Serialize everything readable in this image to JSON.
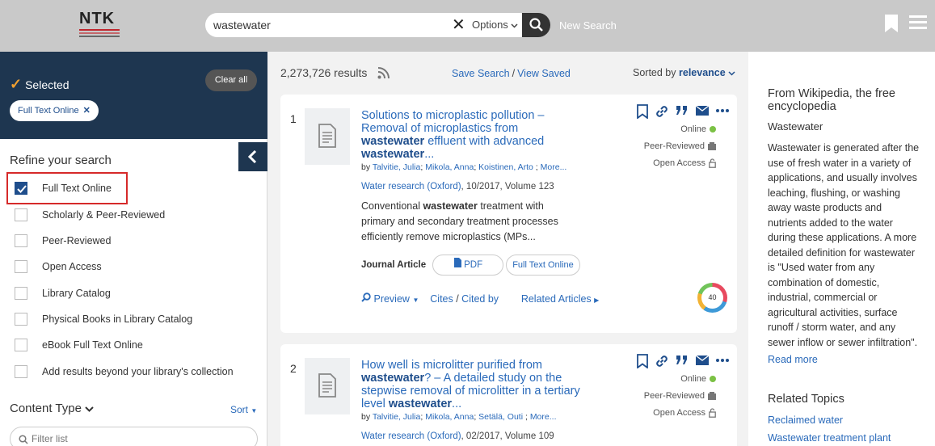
{
  "header": {
    "logo_text": "NTK",
    "search_value": "wastewater",
    "search_placeholder": "",
    "options_label": "Options",
    "new_search_label": "New Search"
  },
  "sidebar": {
    "selected_title": "Selected",
    "clear_all_label": "Clear all",
    "chips": [
      {
        "label": "Full Text Online"
      }
    ],
    "refine_title": "Refine your search",
    "filters": [
      {
        "label": "Full Text Online",
        "checked": true
      },
      {
        "label": "Scholarly & Peer-Reviewed",
        "checked": false
      },
      {
        "label": "Peer-Reviewed",
        "checked": false
      },
      {
        "label": "Open Access",
        "checked": false
      },
      {
        "label": "Library Catalog",
        "checked": false
      },
      {
        "label": "Physical Books in Library Catalog",
        "checked": false
      },
      {
        "label": "eBook Full Text Online",
        "checked": false
      },
      {
        "label": "Add results beyond your library's collection",
        "checked": false
      }
    ],
    "content_type_title": "Content Type",
    "sort_label": "Sort",
    "filter_list_placeholder": "Filter list"
  },
  "results_header": {
    "count": "2,273,726 results",
    "save_search": "Save Search",
    "separator": "/",
    "view_saved": "View Saved",
    "sorted_by_label": "Sorted by",
    "sort_value": "relevance"
  },
  "results": [
    {
      "rank": "1",
      "title_parts": [
        "Solutions to microplastic pollution – Removal of microplastics from ",
        "wastewater",
        " effluent with advanced ",
        "wastewater",
        "..."
      ],
      "authors_by": "by",
      "authors": [
        "Talvitie, Julia",
        "Mikola, Anna",
        "Koistinen, Arto",
        "More..."
      ],
      "journal": "Water research (Oxford)",
      "journal_details": ", 10/2017, Volume 123",
      "snippet_parts": [
        "Conventional ",
        "wastewater",
        " treatment with primary and secondary treatment processes efficiently remove microplastics (MPs..."
      ],
      "type": "Journal Article",
      "pdf_label": "PDF",
      "fto_label": "Full Text Online",
      "preview_label": "Preview",
      "cites_label": "Cites",
      "cited_by_label": "Cited by",
      "related_label": "Related Articles",
      "altmetric": "40",
      "status": [
        "Online",
        "Peer-Reviewed",
        "Open Access"
      ]
    },
    {
      "rank": "2",
      "title_parts": [
        "How well is microlitter purified from ",
        "wastewater",
        "? – A detailed study on the stepwise removal of microlitter in a tertiary level ",
        "wastewater",
        "..."
      ],
      "authors_by": "by",
      "authors": [
        "Talvitie, Julia",
        "Mikola, Anna",
        "Setälä, Outi",
        "More..."
      ],
      "journal": "Water research (Oxford)",
      "journal_details": ", 02/2017, Volume 109",
      "status": [
        "Online",
        "Peer-Reviewed",
        "Open Access"
      ]
    }
  ],
  "wiki": {
    "title": "From Wikipedia, the free encyclopedia",
    "term": "Wastewater",
    "body": "Wastewater is generated after the use of fresh water in a variety of applications, and usually involves leaching, flushing, or washing away waste products and nutrients added to the water during these applications. A more detailed definition for wastewater is \"Used water from any combination of domestic, industrial, commercial or agricultural activities, surface runoff / storm water, and any sewer inflow or sewer infiltration\".",
    "read_more": "Read more",
    "related_title": "Related Topics",
    "topics": [
      "Reclaimed water",
      "Wastewater treatment plant"
    ]
  }
}
